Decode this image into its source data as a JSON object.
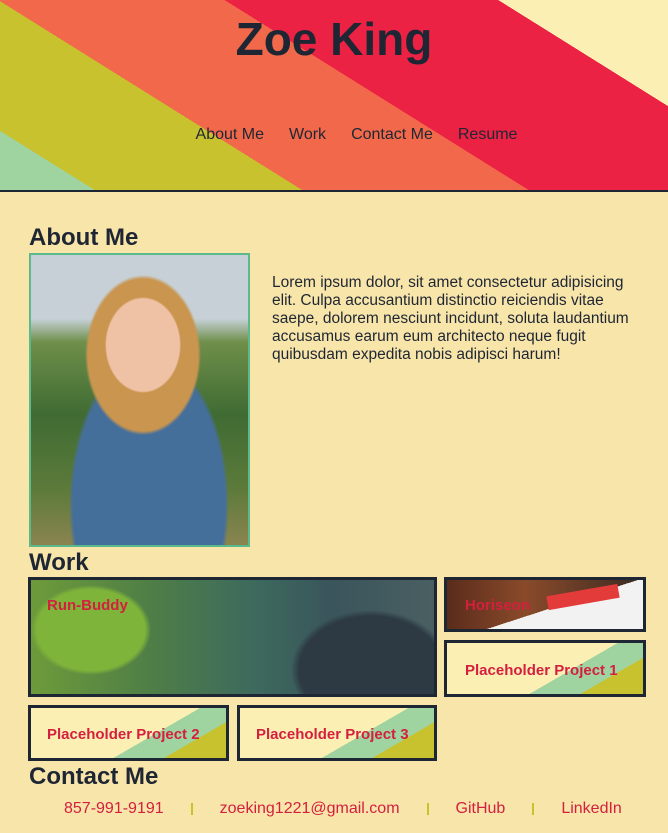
{
  "header": {
    "title": "Zoe King",
    "nav": [
      "About Me",
      "Work",
      "Contact Me",
      "Resume"
    ],
    "stripe_colors": [
      "#ec2245",
      "#f1694a",
      "#c8c22e",
      "#9fd3a0"
    ]
  },
  "about": {
    "title": "About Me",
    "photo_icon": "portrait-photo",
    "text": "Lorem ipsum dolor, sit amet consectetur adipisicing elit. Culpa accusantium distinctio reiciendis vitae saepe, dolorem nesciunt incidunt, soluta laudantium accusamus earum eum architecto neque fugit quibusdam expedita nobis adipisci harum!"
  },
  "work": {
    "title": "Work",
    "projects": [
      {
        "label": "Run-Buddy"
      },
      {
        "label": "Horiseon"
      },
      {
        "label": "Placeholder Project 1"
      },
      {
        "label": "Placeholder Project 2"
      },
      {
        "label": "Placeholder Project 3"
      }
    ]
  },
  "contact": {
    "title": "Contact Me",
    "links": [
      "857-991-9191",
      "zoeking1221@gmail.com",
      "GitHub",
      "LinkedIn"
    ]
  },
  "colors": {
    "background": "#f8e5aa",
    "text": "#1f2633",
    "accent_red": "#d41f3f",
    "accent_green": "#9fd3a0",
    "accent_olive": "#c8c22e"
  }
}
